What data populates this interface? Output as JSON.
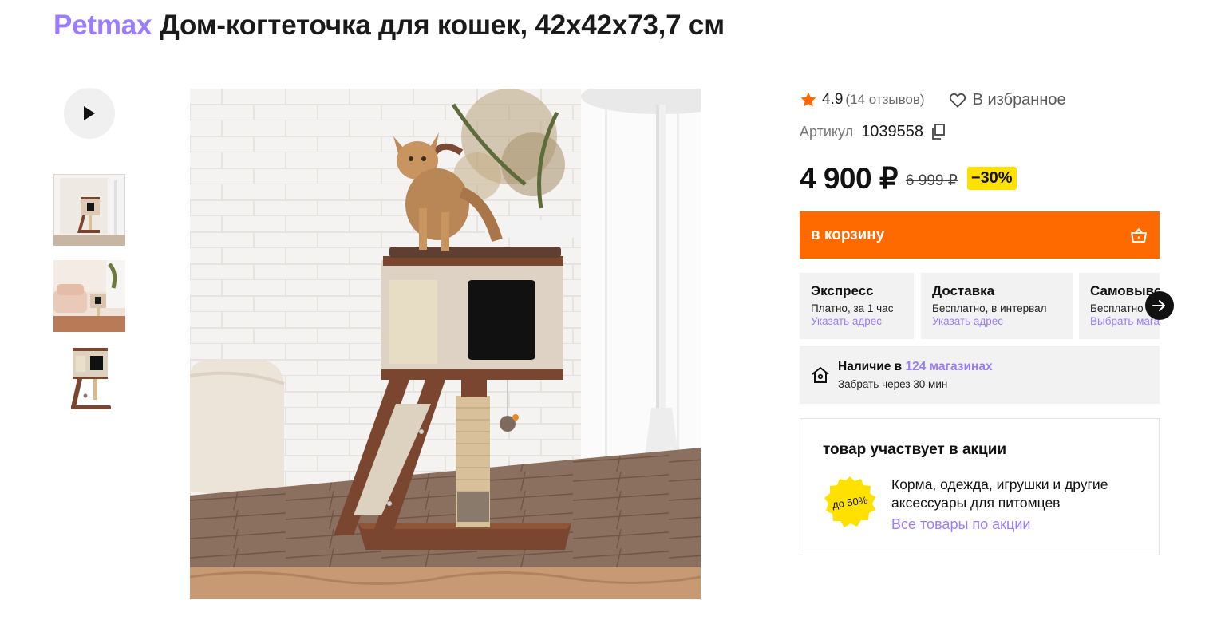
{
  "product": {
    "brand": "Petmax",
    "name": "Дом-когтеточка для кошек, 42x42x73,7 см"
  },
  "gallery": {
    "thumbnails": [
      "thumb-1",
      "thumb-2",
      "thumb-3"
    ],
    "play_icon": "play-icon"
  },
  "rating": {
    "value": "4.9",
    "reviews": "(14 отзывов)"
  },
  "favorite": {
    "label": "В избранное"
  },
  "article": {
    "label": "Артикул",
    "value": "1039558"
  },
  "price": {
    "current": "4 900 ₽",
    "old": "6 999 ₽",
    "discount": "−30%"
  },
  "cart": {
    "label": "в корзину"
  },
  "delivery": [
    {
      "title": "Экспресс",
      "desc": "Платно, за 1 час",
      "link": "Указать адрес"
    },
    {
      "title": "Доставка",
      "desc": "Бесплатно, в интервал",
      "link": "Указать адрес"
    },
    {
      "title": "Самовывоз",
      "desc": "Бесплатно",
      "link": "Выбрать магазин"
    }
  ],
  "stock": {
    "prefix": "Наличие в",
    "link": "124 магазинах",
    "pickup": "Забрать через 30 мин"
  },
  "promo": {
    "title": "товар участвует в акции",
    "badge": "до 50%",
    "desc": "Корма, одежда, игрушки и другие аксессуары для питомцев",
    "link": "Все товары по акции"
  },
  "colors": {
    "accent_purple": "#9b7bff",
    "cart_orange": "#ff6a00",
    "discount_yellow": "#ffe100",
    "star_orange": "#ff6a00"
  }
}
